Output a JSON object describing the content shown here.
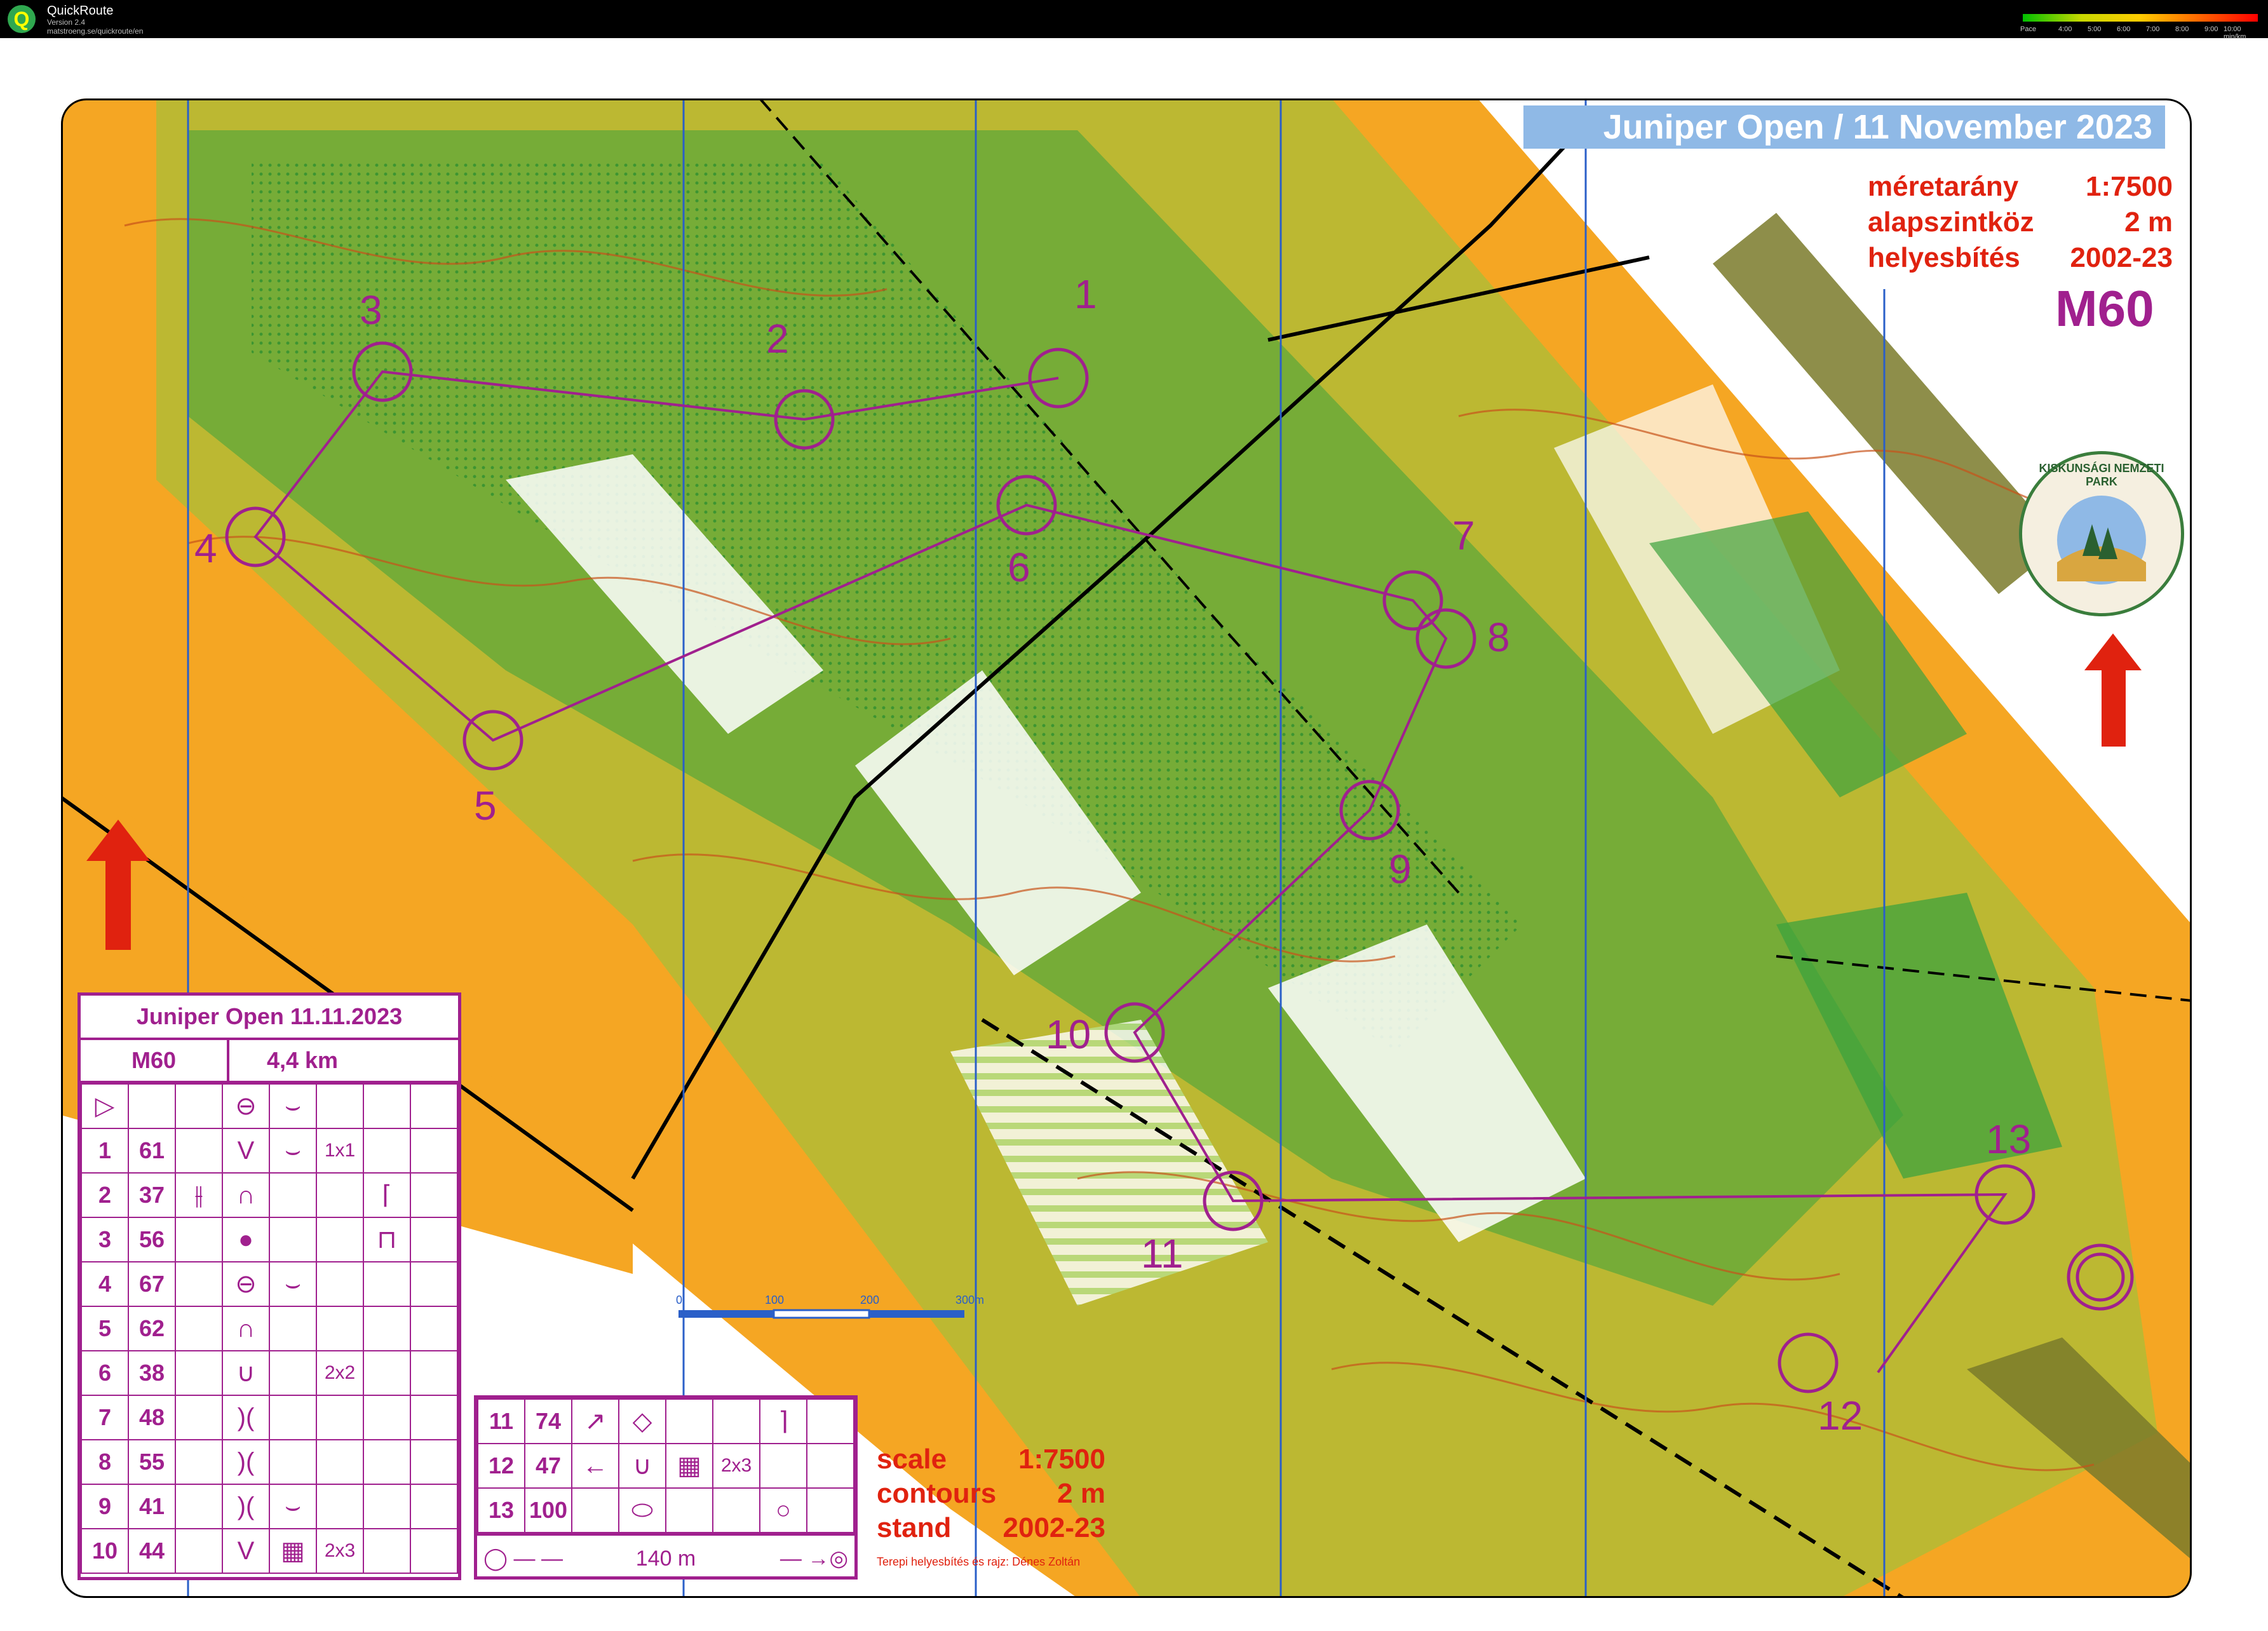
{
  "window": {
    "app_name": "QuickRoute",
    "version": "Version 2.4",
    "url": "matstroeng.se/quickroute/en",
    "pace_label": "Pace",
    "pace_ticks": [
      "4:00",
      "5:00",
      "6:00",
      "7:00",
      "8:00",
      "9:00",
      "10:00 min/km"
    ]
  },
  "map": {
    "event_title": "Juniper Open  /  11 November 2023",
    "meta": [
      {
        "label": "méretarány",
        "value": "1:7500"
      },
      {
        "label": "alapszintköz",
        "value": "2 m"
      },
      {
        "label": "helyesbítés",
        "value": "2002-23"
      }
    ],
    "class_name": "M60",
    "bottom_info": [
      {
        "label": "scale",
        "value": "1:7500"
      },
      {
        "label": "contours",
        "value": "2 m"
      },
      {
        "label": "stand",
        "value": "2002-23"
      }
    ],
    "credit": "Terepi helyesbítés és rajz: Dénes Zoltán",
    "logo_text": "KISKUNSÁGI NEMZETI PARK",
    "scale_labels": [
      "0",
      "100",
      "200",
      "300m"
    ],
    "control_numbers": [
      "1",
      "2",
      "3",
      "4",
      "5",
      "6",
      "7",
      "8",
      "9",
      "10",
      "11",
      "12",
      "13"
    ]
  },
  "descriptions": {
    "title": "Juniper Open 11.11.2023",
    "class": "M60",
    "length": "4,4 km",
    "start_symbol": "▷",
    "rows": [
      {
        "num": "1",
        "code": "61",
        "sym": "V",
        "extra": "1x1"
      },
      {
        "num": "2",
        "code": "37",
        "sym": "∩",
        "extra": ""
      },
      {
        "num": "3",
        "code": "56",
        "sym": "●",
        "extra": ""
      },
      {
        "num": "4",
        "code": "67",
        "sym": "⊖",
        "extra": ""
      },
      {
        "num": "5",
        "code": "62",
        "sym": "∩",
        "extra": ""
      },
      {
        "num": "6",
        "code": "38",
        "sym": "∪",
        "extra": "2x2"
      },
      {
        "num": "7",
        "code": "48",
        "sym": ")(",
        "extra": ""
      },
      {
        "num": "8",
        "code": "55",
        "sym": ")(",
        "extra": ""
      },
      {
        "num": "9",
        "code": "41",
        "sym": ")(",
        "extra": ""
      },
      {
        "num": "10",
        "code": "44",
        "sym": "V",
        "extra": "2x3"
      }
    ],
    "rows2": [
      {
        "num": "11",
        "code": "74",
        "sym": "↗",
        "sym2": "◇",
        "extra": ""
      },
      {
        "num": "12",
        "code": "47",
        "sym": "←",
        "sym2": "∪",
        "extra": "2x3"
      },
      {
        "num": "13",
        "code": "100",
        "sym": "⬭",
        "sym2": "",
        "extra": ""
      }
    ],
    "finish_distance": "140 m"
  },
  "colors": {
    "course": "#a0208e",
    "orange": "#f5a623",
    "green": "#3da33d",
    "light_green": "#b8e08a",
    "contour": "#c8521a",
    "title_bg": "#8fb9e6",
    "meta_red": "#e0220f"
  }
}
